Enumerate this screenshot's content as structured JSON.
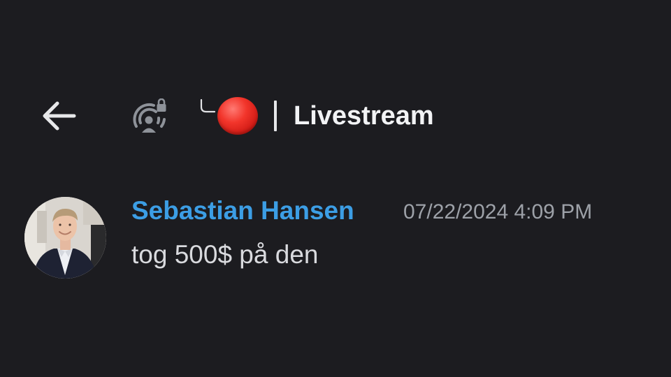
{
  "header": {
    "back_icon": "arrow-left-icon",
    "stage_icon": "locked-stage-channel-icon",
    "thread_icon": "thread-branch-icon",
    "live_indicator_icon": "red-circle-icon",
    "separator": "|",
    "channel_name": "Livestream"
  },
  "message": {
    "avatar_icon": "user-avatar",
    "author": "Sebastian Hansen",
    "timestamp": "07/22/2024 4:09 PM",
    "content": "tog 500$ på den",
    "author_color": "#3c9ee5"
  },
  "colors": {
    "background": "#1c1c20",
    "live_red": "#e8281f",
    "timestamp": "#9da1a8"
  }
}
